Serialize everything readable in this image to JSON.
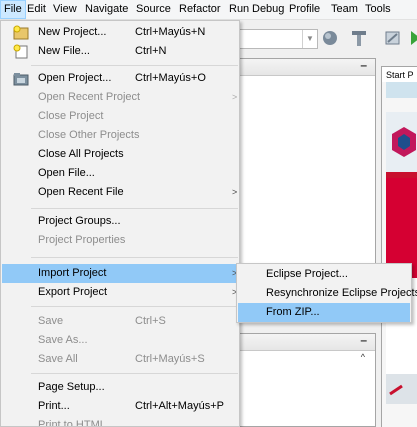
{
  "menubar": {
    "items": [
      "File",
      "Edit",
      "View",
      "Navigate",
      "Source",
      "Refactor",
      "Run",
      "Debug",
      "Profile",
      "Team",
      "Tools"
    ],
    "active": "File"
  },
  "start_page_tab": "Start P",
  "file_menu": {
    "items": [
      {
        "label": "New Project...",
        "shortcut": "Ctrl+Mayús+N",
        "icon": "new-project-icon",
        "enabled": true
      },
      {
        "label": "New File...",
        "shortcut": "Ctrl+N",
        "icon": "new-file-icon",
        "enabled": true
      },
      {
        "label": "Open Project...",
        "shortcut": "Ctrl+Mayús+O",
        "icon": "open-project-icon",
        "enabled": true
      },
      {
        "label": "Open Recent Project",
        "shortcut": "",
        "submenu": true,
        "enabled": false
      },
      {
        "label": "Close Project",
        "shortcut": "",
        "enabled": false
      },
      {
        "label": "Close Other Projects",
        "shortcut": "",
        "enabled": false
      },
      {
        "label": "Close All Projects",
        "shortcut": "",
        "enabled": true
      },
      {
        "label": "Open File...",
        "shortcut": "",
        "enabled": true
      },
      {
        "label": "Open Recent File",
        "shortcut": "",
        "submenu": true,
        "enabled": true
      },
      {
        "label": "Project Groups...",
        "shortcut": "",
        "enabled": true
      },
      {
        "label": "Project Properties",
        "shortcut": "",
        "enabled": false
      },
      {
        "label": "Import Project",
        "shortcut": "",
        "submenu": true,
        "enabled": true,
        "highlighted": true
      },
      {
        "label": "Export Project",
        "shortcut": "",
        "submenu": true,
        "enabled": true
      },
      {
        "label": "Save",
        "shortcut": "Ctrl+S",
        "enabled": false
      },
      {
        "label": "Save As...",
        "shortcut": "",
        "enabled": false
      },
      {
        "label": "Save All",
        "shortcut": "Ctrl+Mayús+S",
        "enabled": false
      },
      {
        "label": "Page Setup...",
        "shortcut": "",
        "enabled": true
      },
      {
        "label": "Print...",
        "shortcut": "Ctrl+Alt+Mayús+P",
        "enabled": true
      },
      {
        "label": "Print to HTML...",
        "shortcut": "",
        "enabled": false
      }
    ]
  },
  "import_submenu": {
    "items": [
      {
        "label": "Eclipse Project..."
      },
      {
        "label": "Resynchronize Eclipse Projects"
      },
      {
        "label": "From ZIP...",
        "highlighted": true
      }
    ]
  },
  "colors": {
    "highlight": "#91c9f7",
    "disabled_text": "#8d8d8d",
    "menu_bg": "#f2f2f2"
  }
}
